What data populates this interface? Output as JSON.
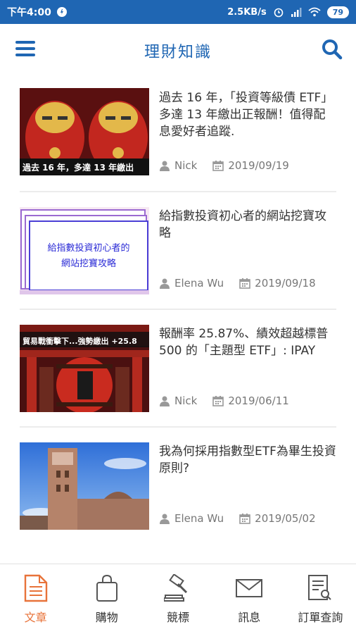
{
  "status_bar": {
    "time": "下午4:00",
    "net_speed": "2.5KB/s",
    "battery": "79"
  },
  "header": {
    "title": "理財知識"
  },
  "articles": [
    {
      "title": "過去 16 年，「投資等級債 ETF」多達 13 年繳出正報酬！值得配息愛好者追蹤.",
      "author": "Nick",
      "date": "2019/09/19",
      "thumb_caption": "過去 16 年，多達 13 年繳出"
    },
    {
      "title": "給指數投資初心者的網站挖寶攻略",
      "author": "Elena Wu",
      "date": "2019/09/18",
      "thumb_caption_1": "給指數投資初心者的",
      "thumb_caption_2": "網站挖寶攻略"
    },
    {
      "title": "報酬率 25.87%、績效超越標普 500 的「主題型 ETF」: IPAY",
      "author": "Nick",
      "date": "2019/06/11",
      "thumb_caption": "貿易戰衝擊下...強勢繳出 +25.8"
    },
    {
      "title": "我為何採用指數型ETF為畢生投資原則?",
      "author": "Elena Wu",
      "date": "2019/05/02"
    }
  ],
  "tabs": [
    {
      "label": "文章",
      "icon": "document-icon",
      "active": true
    },
    {
      "label": "購物",
      "icon": "shopping-bag-icon",
      "active": false
    },
    {
      "label": "競標",
      "icon": "gavel-icon",
      "active": false
    },
    {
      "label": "訊息",
      "icon": "envelope-icon",
      "active": false
    },
    {
      "label": "訂單查詢",
      "icon": "order-search-icon",
      "active": false
    }
  ],
  "colors": {
    "primary": "#1f66b3",
    "accent": "#e8733a"
  }
}
